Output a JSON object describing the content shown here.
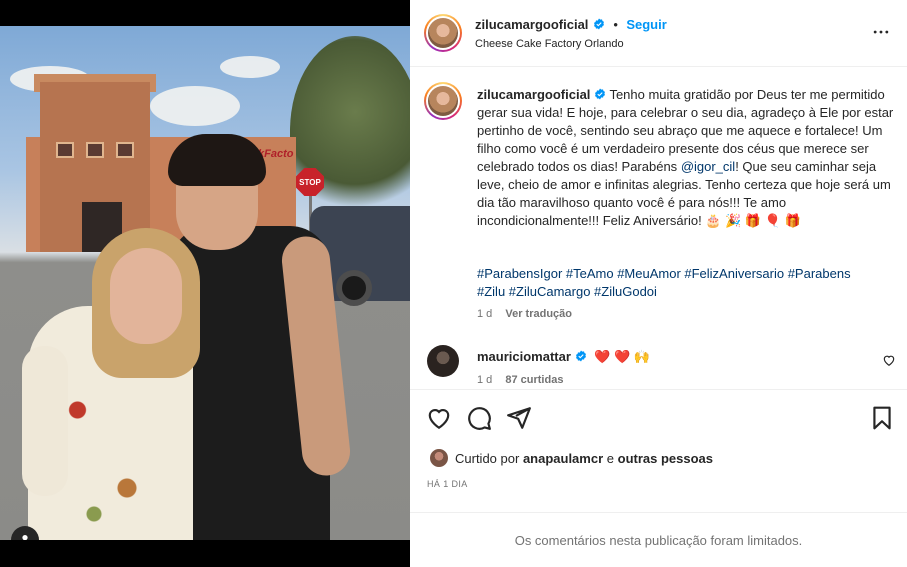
{
  "post": {
    "author": "zilucamargooficial",
    "follow_label": "Seguir",
    "separator": "•",
    "location": "Cheese Cake Factory Orlando",
    "photo_sign_text": "kFacto",
    "stop_sign_text": "STOP"
  },
  "caption": {
    "author": "zilucamargooficial",
    "text_before_mention": "Tenho muita gratidão por Deus ter me permitido gerar sua vida! E hoje, para celebrar o seu dia, agradeço à Ele por estar pertinho de você, sentindo seu abraço que me aquece e fortalece! Um filho como você é um verdadeiro presente dos céus que merece ser celebrado todos os dias! Parabéns ",
    "mention": "@igor_cil",
    "text_after_mention": "! Que seu caminhar seja leve, cheio de amor e infinitas alegrias. Tenho certeza que hoje será um dia tão maravilhoso quanto você é para nós!!! Te amo incondicionalmente!!! Feliz Aniversário! 🎂 🎉 🎁 🎈 🎁",
    "hashtags_line1": "#ParabensIgor #TeAmo #MeuAmor #FelizAniversario #Parabens",
    "hashtags_line2": "#Zilu #ZiluCamargo #ZiluGodoi",
    "age": "1 d",
    "translate_label": "Ver tradução"
  },
  "comment": {
    "author": "mauriciomattar",
    "text": "❤️ ❤️ 🙌",
    "age": "1 d",
    "likes": "87 curtidas"
  },
  "likes": {
    "prefix": "Curtido por",
    "user": "anapaulamcr",
    "connector": "e",
    "others": "outras pessoas"
  },
  "date_label": "HÁ 1 DIA",
  "footer_text": "Os comentários nesta publicação foram limitados.",
  "icons": {
    "verified": "verified-badge-icon",
    "more": "more-options-icon",
    "like": "heart-icon",
    "comment": "comment-icon",
    "share": "share-icon",
    "save": "bookmark-icon",
    "tag": "user-tag-icon"
  },
  "colors": {
    "accent": "#0095f6",
    "link": "#00376b",
    "muted": "#737373",
    "heart_red": "#ed4956"
  }
}
